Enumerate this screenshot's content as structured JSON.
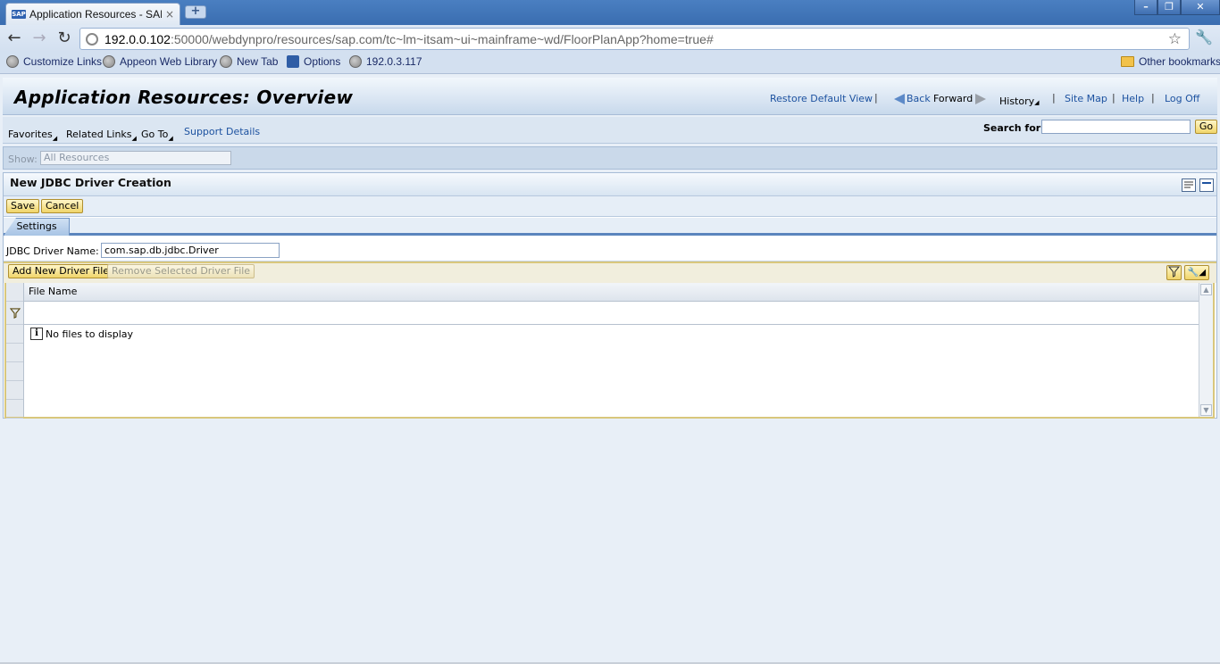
{
  "browser": {
    "tab_title": "Application Resources - SAP N",
    "favicon_text": "SAP",
    "tab_close": "×",
    "new_tab": "+",
    "url_host": "192.0.0.102",
    "url_path": ":50000/webdynpro/resources/sap.com/tc~lm~itsam~ui~mainframe~wd/FloorPlanApp?home=true#",
    "bookmarks": [
      {
        "label": "Customize Links",
        "icon": "globe-icon"
      },
      {
        "label": "Appeon Web Library",
        "icon": "globe-icon"
      },
      {
        "label": "New Tab",
        "icon": "globe-icon"
      },
      {
        "label": "Options",
        "icon": "options-icon"
      },
      {
        "label": "192.0.3.117",
        "icon": "globe-icon"
      }
    ],
    "other_bookmarks": "Other bookmarks"
  },
  "header": {
    "title": "Application Resources: Overview",
    "restore": "Restore Default View",
    "back": "Back",
    "forward": "Forward",
    "history": "History",
    "sitemap": "Site Map",
    "help": "Help",
    "logoff": "Log Off"
  },
  "menubar": {
    "favorites": "Favorites",
    "related": "Related Links",
    "goto": "Go To",
    "support": "Support Details",
    "search_label": "Search for:",
    "go": "Go"
  },
  "show": {
    "label": "Show:",
    "value": "All Resources"
  },
  "panel": {
    "title": "New JDBC Driver Creation",
    "save": "Save",
    "cancel": "Cancel",
    "tab_settings": "Settings",
    "driver_label": "JDBC Driver Name:",
    "required_mark": "*",
    "driver_value": "com.sap.db.jdbc.Driver",
    "add_file": "Add New Driver File",
    "remove_file": "Remove Selected Driver File",
    "col_filename": "File Name",
    "empty": "No files to display"
  }
}
